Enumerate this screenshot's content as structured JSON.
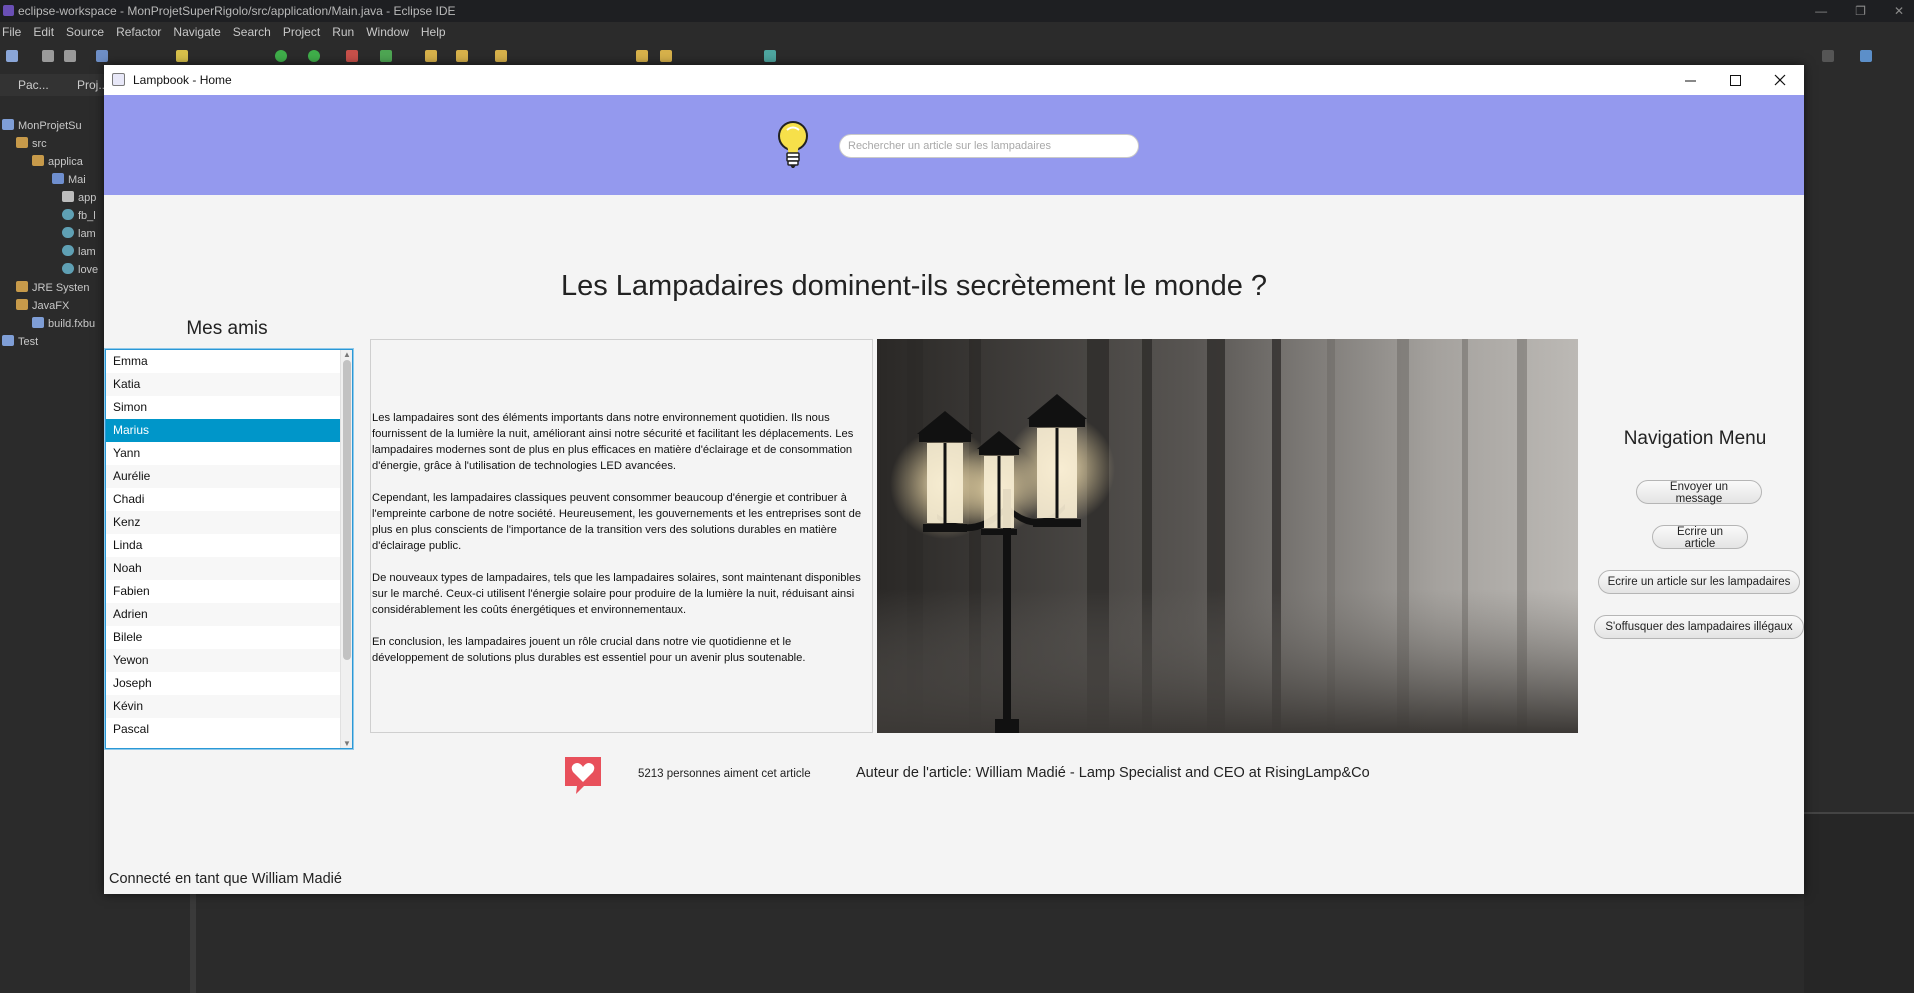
{
  "eclipse": {
    "window_title": "eclipse-workspace - MonProjetSuperRigolo/src/application/Main.java - Eclipse IDE",
    "menu": [
      "File",
      "Edit",
      "Source",
      "Refactor",
      "Navigate",
      "Search",
      "Project",
      "Run",
      "Window",
      "Help"
    ],
    "tabs": [
      "Pac...",
      "Proj..."
    ],
    "tree": [
      "MonProjetSu",
      "src",
      "applica",
      "Mai",
      "app",
      "fb_l",
      "lam",
      "lam",
      "love",
      "JRE Systen",
      "JavaFX",
      "build.fxbu",
      "Test"
    ]
  },
  "app": {
    "title": "Lampbook - Home",
    "search": {
      "placeholder": "Rechercher un article sur les lampadaires",
      "value": ""
    },
    "article_title": "Les Lampadaires dominent-ils secrètement le monde ?",
    "friends_title": "Mes amis",
    "friends": [
      "Emma",
      "Katia",
      "Simon",
      "Marius",
      "Yann",
      "Aurélie",
      "Chadi",
      "Kenz",
      "Linda",
      "Noah",
      "Fabien",
      "Adrien",
      "Bilele",
      "Yewon",
      "Joseph",
      "Kévin",
      "Pascal"
    ],
    "selected_friend": "Marius",
    "article_paragraphs": [
      "Les lampadaires sont des éléments importants dans notre environnement quotidien. Ils nous fournissent de la lumière la nuit, améliorant ainsi notre sécurité et facilitant les déplacements. Les lampadaires modernes sont de plus en plus efficaces en matière d'éclairage et de consommation d'énergie, grâce à l'utilisation de technologies LED avancées.",
      "Cependant, les lampadaires classiques peuvent consommer beaucoup d'énergie et contribuer à l'empreinte carbone de notre société. Heureusement, les gouvernements et les entreprises sont de plus en plus conscients de l'importance de la transition vers des solutions durables en matière d'éclairage public.",
      "De nouveaux types de lampadaires, tels que les lampadaires solaires, sont maintenant disponibles sur le marché. Ceux-ci utilisent l'énergie solaire pour produire de la lumière la nuit, réduisant ainsi considérablement les coûts énergétiques et environnementaux.",
      "En conclusion, les lampadaires jouent un rôle crucial dans notre vie quotidienne et le développement de solutions plus durables est essentiel pour un avenir plus soutenable."
    ],
    "nav_title": "Navigation Menu",
    "nav_buttons": [
      "Envoyer un message",
      "Ecrire un article",
      "Ecrire un article sur les lampadaires",
      "S'offusquer des lampadaires illégaux"
    ],
    "likes_text": "5213 personnes aiment cet article",
    "author_text": "Auteur de l'article: William Madié - Lamp Specialist and CEO at RisingLamp&Co",
    "connected_text": "Connecté en tant que William Madié",
    "colors": {
      "header": "#9499ee",
      "selection": "#0096c9",
      "heart": "#e8505b"
    }
  }
}
